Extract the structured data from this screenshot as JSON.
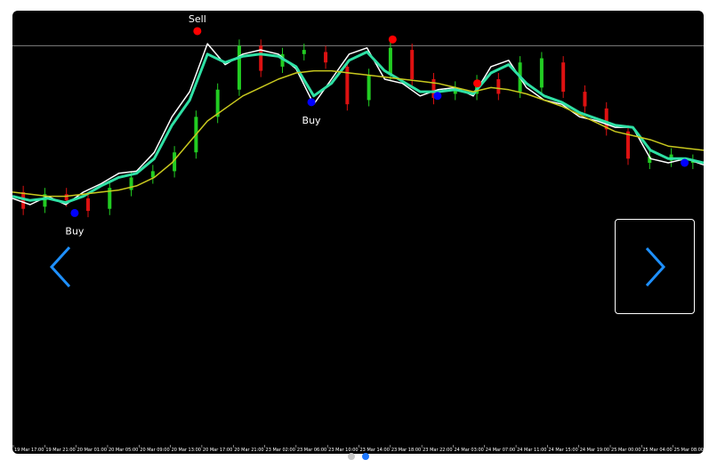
{
  "chart_data": {
    "type": "line",
    "instrument_view": "candlestick with moving averages",
    "x_labels": [
      "19 Mar 17:00",
      "19 Mar 21:00",
      "20 Mar 01:00",
      "20 Mar 05:00",
      "20 Mar 09:00",
      "20 Mar 13:00",
      "20 Mar 17:00",
      "20 Mar 21:00",
      "23 Mar 02:00",
      "23 Mar 06:00",
      "23 Mar 10:00",
      "23 Mar 14:00",
      "23 Mar 18:00",
      "23 Mar 22:00",
      "24 Mar 03:00",
      "24 Mar 07:00",
      "24 Mar 11:00",
      "24 Mar 15:00",
      "24 Mar 19:00",
      "25 Mar 00:00",
      "25 Mar 04:00",
      "25 Mar 08:00"
    ],
    "ylim": [
      0,
      100
    ],
    "series": [
      {
        "color": "#ffffff",
        "values": [
          23,
          20,
          24,
          20,
          26,
          30,
          35,
          36,
          45,
          62,
          74,
          97,
          87,
          92,
          94,
          92,
          85,
          68,
          80,
          92,
          95,
          80,
          78,
          72,
          75,
          76,
          72,
          86,
          89,
          76,
          70,
          68,
          62,
          60,
          57,
          57,
          42,
          40,
          42,
          39
        ]
      },
      {
        "color": "#2ee0a4",
        "values": [
          24,
          22,
          23,
          21,
          24,
          29,
          33,
          35,
          42,
          58,
          70,
          92,
          88,
          91,
          92,
          91,
          86,
          72,
          78,
          89,
          93,
          84,
          79,
          74,
          74,
          75,
          73,
          83,
          87,
          78,
          72,
          69,
          64,
          61,
          58,
          57,
          46,
          42,
          42,
          40
        ]
      },
      {
        "color": "#c8c81e",
        "values": [
          26,
          25,
          24,
          24,
          25,
          26,
          27,
          29,
          33,
          40,
          50,
          60,
          66,
          72,
          76,
          80,
          83,
          84,
          84,
          83,
          82,
          81,
          80,
          79,
          78,
          76,
          74,
          76,
          75,
          73,
          70,
          67,
          63,
          59,
          55,
          53,
          51,
          48,
          47,
          46
        ]
      }
    ],
    "candles": [
      {
        "dir": "down",
        "o": 26,
        "c": 18
      },
      {
        "dir": "up",
        "o": 19,
        "c": 25
      },
      {
        "dir": "down",
        "o": 25,
        "c": 22
      },
      {
        "dir": "down",
        "o": 23,
        "c": 17
      },
      {
        "dir": "up",
        "o": 18,
        "c": 28
      },
      {
        "dir": "up",
        "o": 27,
        "c": 33
      },
      {
        "dir": "up",
        "o": 33,
        "c": 36
      },
      {
        "dir": "up",
        "o": 36,
        "c": 45
      },
      {
        "dir": "up",
        "o": 45,
        "c": 62
      },
      {
        "dir": "up",
        "o": 62,
        "c": 75
      },
      {
        "dir": "up",
        "o": 75,
        "c": 96
      },
      {
        "dir": "down",
        "o": 96,
        "c": 84
      },
      {
        "dir": "up",
        "o": 86,
        "c": 92
      },
      {
        "dir": "up",
        "o": 92,
        "c": 94
      },
      {
        "dir": "down",
        "o": 93,
        "c": 88
      },
      {
        "dir": "down",
        "o": 86,
        "c": 68
      },
      {
        "dir": "up",
        "o": 70,
        "c": 82
      },
      {
        "dir": "up",
        "o": 82,
        "c": 95
      },
      {
        "dir": "down",
        "o": 94,
        "c": 80
      },
      {
        "dir": "down",
        "o": 80,
        "c": 71
      },
      {
        "dir": "up",
        "o": 73,
        "c": 76
      },
      {
        "dir": "up",
        "o": 73,
        "c": 79
      },
      {
        "dir": "down",
        "o": 80,
        "c": 73
      },
      {
        "dir": "up",
        "o": 74,
        "c": 88
      },
      {
        "dir": "up",
        "o": 76,
        "c": 90
      },
      {
        "dir": "down",
        "o": 88,
        "c": 74
      },
      {
        "dir": "down",
        "o": 74,
        "c": 67
      },
      {
        "dir": "down",
        "o": 66,
        "c": 56
      },
      {
        "dir": "down",
        "o": 55,
        "c": 42
      },
      {
        "dir": "up",
        "o": 40,
        "c": 43
      },
      {
        "dir": "up",
        "o": 41,
        "c": 44
      },
      {
        "dir": "up",
        "o": 40,
        "c": 41
      }
    ],
    "signals": [
      {
        "label": "Buy",
        "color": "#0000ff",
        "x_index": 3.6,
        "value": 16
      },
      {
        "label": "Sell",
        "color": "#ff0000",
        "x_index": 10.7,
        "value": 103
      },
      {
        "label": "",
        "color": "#ff0000",
        "x_index": 22.0,
        "value": 99
      },
      {
        "label": "Buy",
        "color": "#0000ff",
        "x_index": 17.3,
        "value": 69
      },
      {
        "label": "",
        "color": "#0000ff",
        "x_index": 24.6,
        "value": 72
      },
      {
        "label": "",
        "color": "#ff0000",
        "x_index": 26.9,
        "value": 78
      },
      {
        "label": "",
        "color": "#0000ff",
        "x_index": 38.9,
        "value": 40
      }
    ],
    "reference_line": {
      "color": "#808080",
      "value": 96
    },
    "grid": false
  },
  "carousel": {
    "active_dot_color": "#1e78ff",
    "inactive_dot_color": "#c8c8c8",
    "dots": 2,
    "active_index": 1
  },
  "icons": {
    "prev": "chevron-left-icon",
    "next": "chevron-right-icon"
  }
}
